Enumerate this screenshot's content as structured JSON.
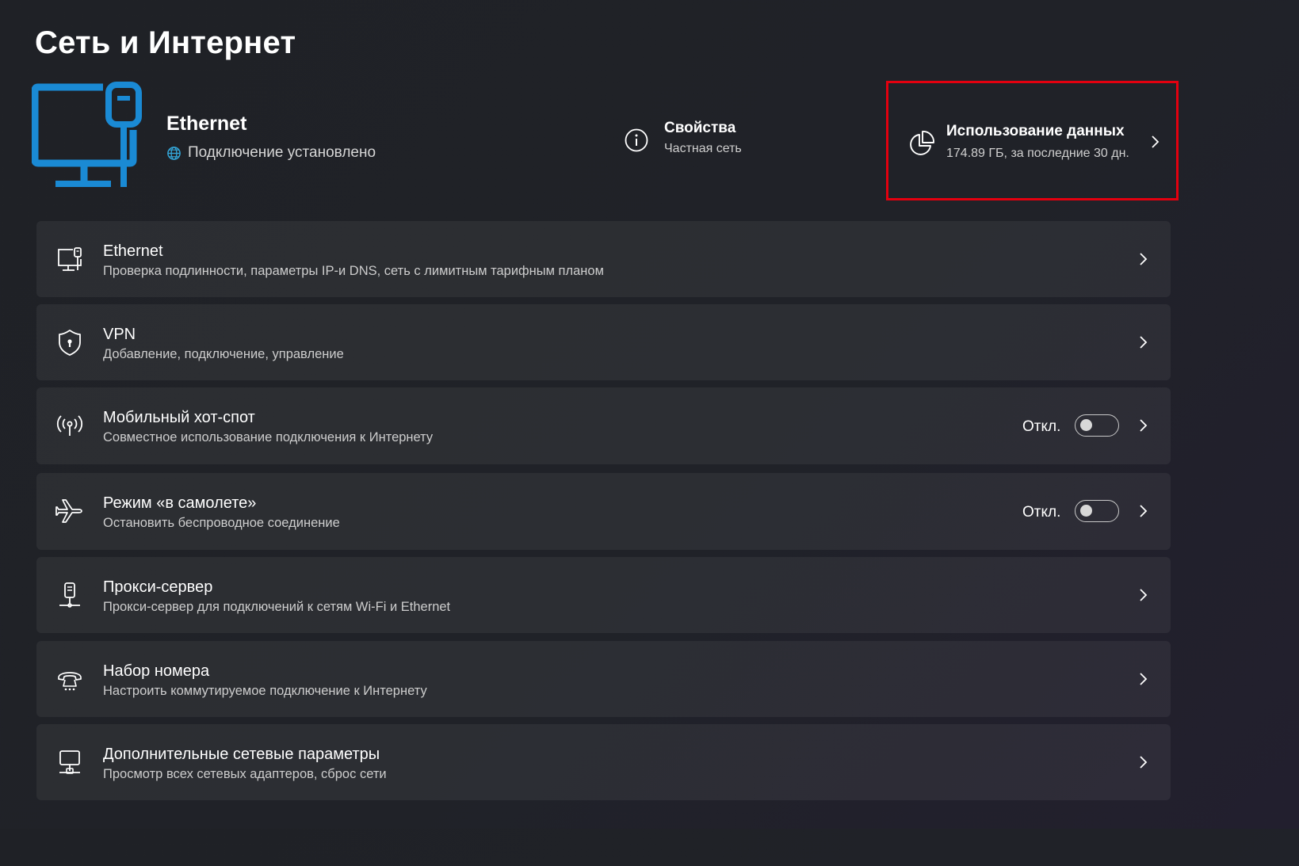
{
  "page": {
    "title": "Сеть и Интернет"
  },
  "hero": {
    "name": "Ethernet",
    "status": "Подключение установлено",
    "icon": "ethernet-monitor-icon",
    "accent_color": "#1a8ad4"
  },
  "properties": {
    "title": "Свойства",
    "subtitle": "Частная сеть",
    "icon": "info-icon"
  },
  "data_usage": {
    "title": "Использование данных",
    "subtitle": "174.89 ГБ, за последние 30 дн.",
    "icon": "pie-chart-icon",
    "highlight_color": "#e3000f"
  },
  "items": [
    {
      "title": "Ethernet",
      "desc": "Проверка подлинности, параметры IP-и DNS, сеть с лимитным тарифным планом",
      "icon": "ethernet-icon"
    },
    {
      "title": "VPN",
      "desc": "Добавление, подключение, управление",
      "icon": "vpn-shield-icon"
    },
    {
      "title": "Мобильный хот-спот",
      "desc": "Совместное использование подключения к Интернету",
      "icon": "hotspot-icon",
      "state": "Откл.",
      "toggle": false
    },
    {
      "title": "Режим «в самолете»",
      "desc": "Остановить беспроводное соединение",
      "icon": "airplane-icon",
      "state": "Откл.",
      "toggle": false
    },
    {
      "title": "Прокси-сервер",
      "desc": "Прокси-сервер для подключений к сетям Wi-Fi и Ethernet",
      "icon": "proxy-icon"
    },
    {
      "title": "Набор номера",
      "desc": "Настроить коммутируемое подключение к Интернету",
      "icon": "dialup-icon"
    },
    {
      "title": "Дополнительные сетевые параметры",
      "desc": "Просмотр всех сетевых адаптеров, сброс сети",
      "icon": "network-adapter-icon"
    }
  ]
}
